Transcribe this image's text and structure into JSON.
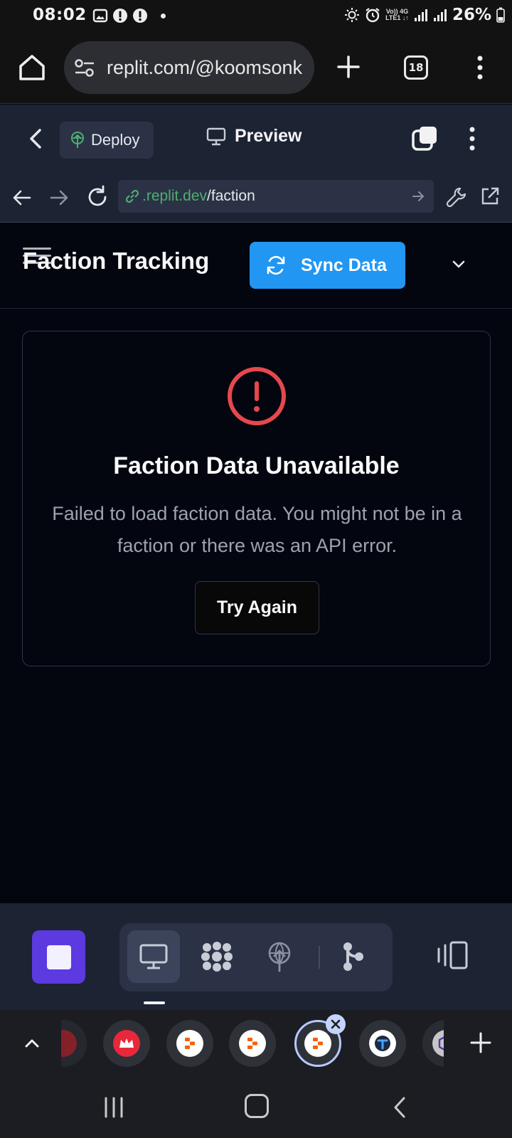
{
  "status_bar": {
    "time": "08:02",
    "network_line1": "Vo)) 4G",
    "network_line2": "LTE1 ↓↑",
    "battery": "26%"
  },
  "browser": {
    "url": "replit.com/@koomsonk",
    "tab_count": "18"
  },
  "replit_header": {
    "deploy_label": "Deploy",
    "preview_label": "Preview"
  },
  "webview": {
    "url_domain": ".replit.dev",
    "url_path": "/faction"
  },
  "app": {
    "title": "Faction Tracking",
    "sync_label": "Sync Data"
  },
  "error_card": {
    "title": "Faction Data Unavailable",
    "message": "Failed to load faction data. You might not be in a faction or there was an API error.",
    "retry_label": "Try Again"
  },
  "colors": {
    "accent_blue": "#2196f3",
    "error_red": "#e5484d",
    "stop_purple": "#5c3ae0",
    "replit_green": "#4caf71"
  }
}
